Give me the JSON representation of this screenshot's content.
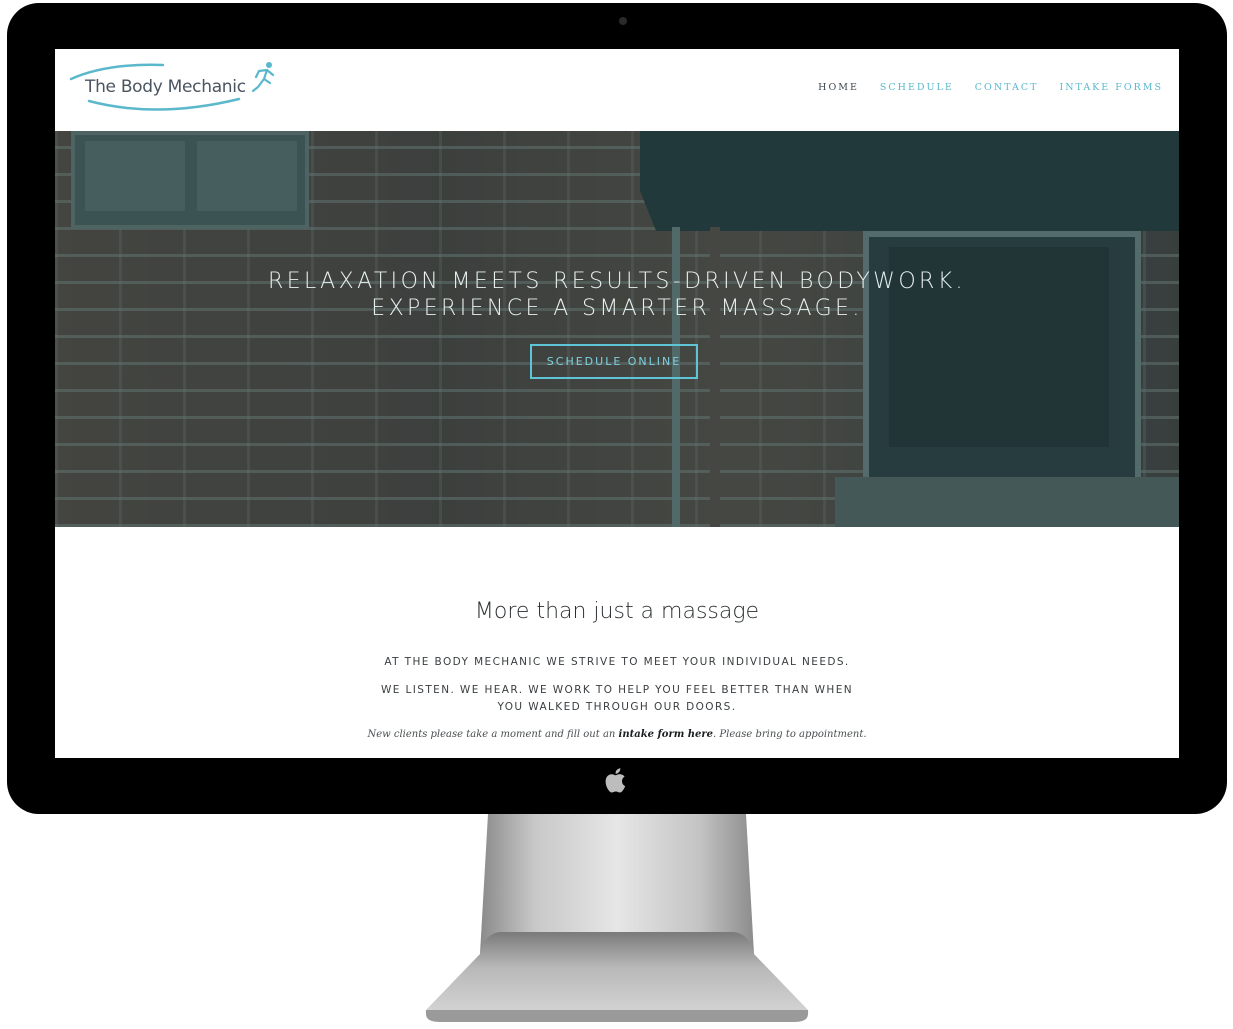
{
  "site": {
    "logo_text": "The Body Mechanic",
    "brand_color": "#5bb8cc"
  },
  "nav": {
    "items": [
      {
        "label": "HOME",
        "active": true
      },
      {
        "label": "SCHEDULE",
        "active": false
      },
      {
        "label": "CONTACT",
        "active": false
      },
      {
        "label": "INTAKE FORMS",
        "active": false
      }
    ]
  },
  "hero": {
    "heading_line1": "RELAXATION MEETS RESULTS-DRIVEN BODYWORK.",
    "heading_line2": "EXPERIENCE A SMARTER MASSAGE.",
    "button_label": "SCHEDULE ONLINE"
  },
  "content": {
    "title": "More than just a massage",
    "paragraph1": "AT THE BODY MECHANIC WE STRIVE TO MEET YOUR INDIVIDUAL NEEDS.",
    "paragraph2_line1": "WE LISTEN. WE HEAR. WE WORK TO HELP YOU FEEL BETTER THAN WHEN",
    "paragraph2_line2": "YOU WALKED THROUGH OUR DOORS.",
    "note_before": "New clients please take a moment and fill out an ",
    "note_link": "intake form here",
    "note_after": ". Please bring to appointment."
  },
  "device": {
    "icons": [
      "camera-icon",
      "apple-logo-icon"
    ]
  }
}
